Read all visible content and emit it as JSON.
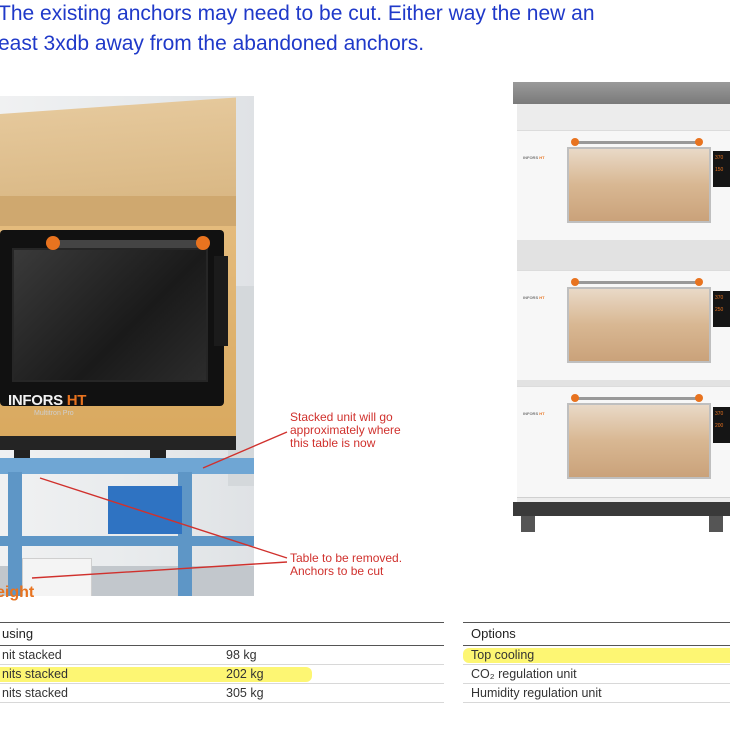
{
  "intro": {
    "line1": "The existing anchors may need to be cut. Either way the new an",
    "line2": "east 3xdb away from the abandoned anchors."
  },
  "photo_left": {
    "brand": "INFORS",
    "brand_accent": "HT",
    "model": "Multitron Pro"
  },
  "annotations": {
    "stacked_unit": [
      "Stacked unit will go",
      "approximately where",
      "this table is now"
    ],
    "table_removed": [
      "Table to be removed.",
      "Anchors to be cut"
    ]
  },
  "photo_right": {
    "brand": "INFORS",
    "brand_accent": "HT",
    "units": [
      {
        "display_top": "370",
        "display_bottom": "150"
      },
      {
        "display_top": "370",
        "display_bottom": "250"
      },
      {
        "display_top": "370",
        "display_bottom": "200"
      }
    ]
  },
  "weight_section": {
    "heading": "eight"
  },
  "housing_table": {
    "header": "using",
    "rows": [
      {
        "label": "nit stacked",
        "value": "98 kg",
        "highlighted": false
      },
      {
        "label": "nits stacked",
        "value": "202 kg",
        "highlighted": true
      },
      {
        "label": "nits stacked",
        "value": "305 kg",
        "highlighted": false
      }
    ]
  },
  "options_table": {
    "header": "Options",
    "rows": [
      {
        "label": "Top cooling",
        "highlighted": true
      },
      {
        "label": "CO₂ regulation unit",
        "highlighted": false
      },
      {
        "label": "Humidity regulation unit",
        "highlighted": false
      }
    ]
  },
  "colors": {
    "intro_text": "#1f39c9",
    "annotation": "#d0312d",
    "brand_orange": "#e8731f",
    "highlight": "#fdf55a"
  }
}
